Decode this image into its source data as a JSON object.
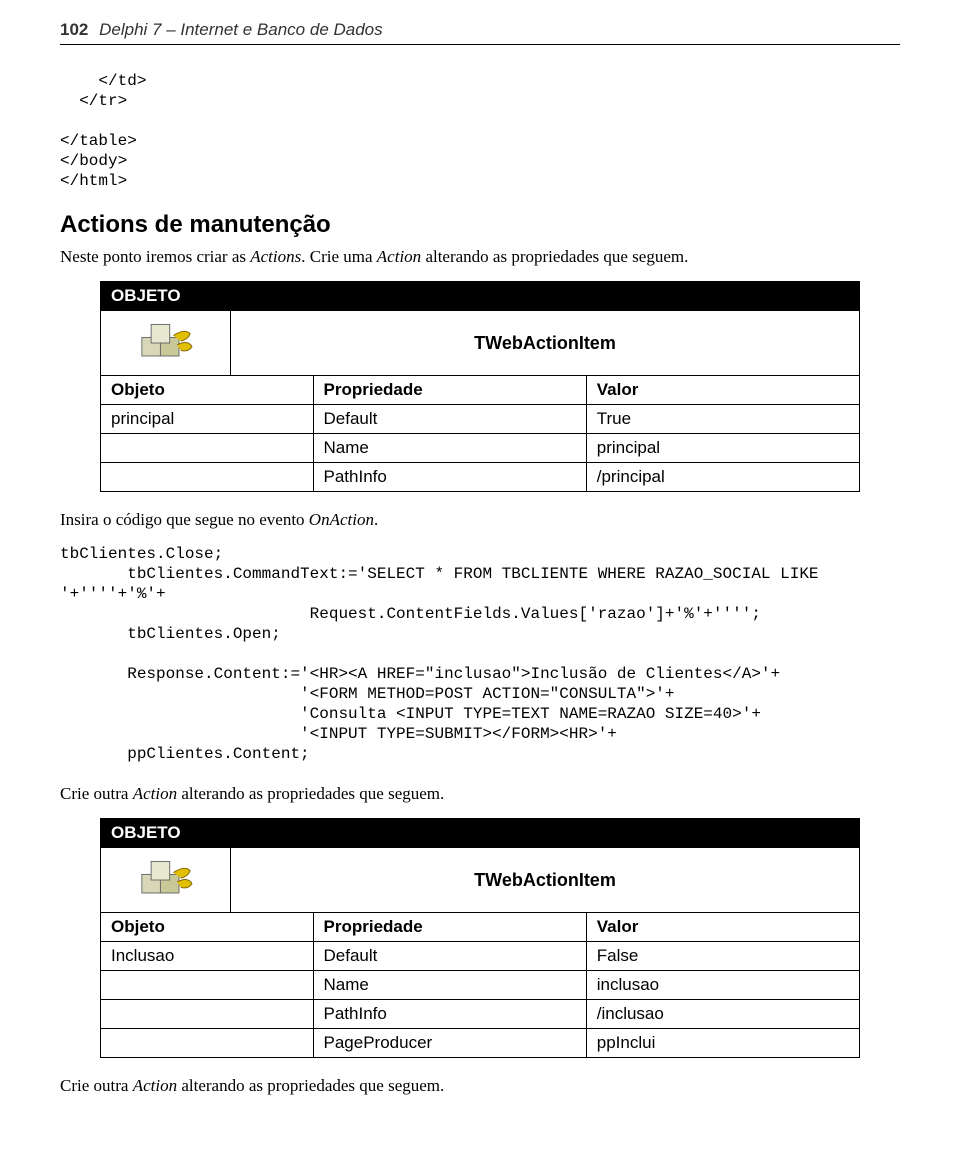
{
  "header": {
    "page_num": "102",
    "title": "Delphi 7 – Internet e Banco de Dados"
  },
  "code1": "    </td>\n  </tr>\n\n</table>\n</body>\n</html>",
  "section1_title": "Actions de manutenção",
  "para1_a": "Neste ponto iremos criar as ",
  "para1_b": "Actions",
  "para1_c": ". Crie uma ",
  "para1_d": "Action",
  "para1_e": " alterando as propriedades que seguem.",
  "table1": {
    "header": "OBJETO",
    "type": "TWebActionItem",
    "cols": [
      "Objeto",
      "Propriedade",
      "Valor"
    ],
    "rows": [
      [
        "principal",
        "Default",
        "True"
      ],
      [
        "",
        "Name",
        "principal"
      ],
      [
        "",
        "PathInfo",
        "/principal"
      ]
    ]
  },
  "para2_a": "Insira o código que segue no evento ",
  "para2_b": "OnAction",
  "para2_c": ".",
  "code2": "tbClientes.Close;\n       tbClientes.CommandText:='SELECT * FROM TBCLIENTE WHERE RAZAO_SOCIAL LIKE\n'+''''+'%'+\n                          Request.ContentFields.Values['razao']+'%'+'''';\n       tbClientes.Open;\n\n       Response.Content:='<HR><A HREF=\"inclusao\">Inclusão de Clientes</A>'+\n                         '<FORM METHOD=POST ACTION=\"CONSULTA\">'+\n                         'Consulta <INPUT TYPE=TEXT NAME=RAZAO SIZE=40>'+\n                         '<INPUT TYPE=SUBMIT></FORM><HR>'+\n       ppClientes.Content;",
  "para3_a": "Crie outra ",
  "para3_b": "Action",
  "para3_c": " alterando as propriedades que seguem.",
  "table2": {
    "header": "OBJETO",
    "type": "TWebActionItem",
    "cols": [
      "Objeto",
      "Propriedade",
      "Valor"
    ],
    "rows": [
      [
        "Inclusao",
        "Default",
        "False"
      ],
      [
        "",
        "Name",
        "inclusao"
      ],
      [
        "",
        "PathInfo",
        "/inclusao"
      ],
      [
        "",
        "PageProducer",
        "ppInclui"
      ]
    ]
  },
  "para4_a": "Crie outra ",
  "para4_b": "Action",
  "para4_c": " alterando as propriedades que seguem."
}
